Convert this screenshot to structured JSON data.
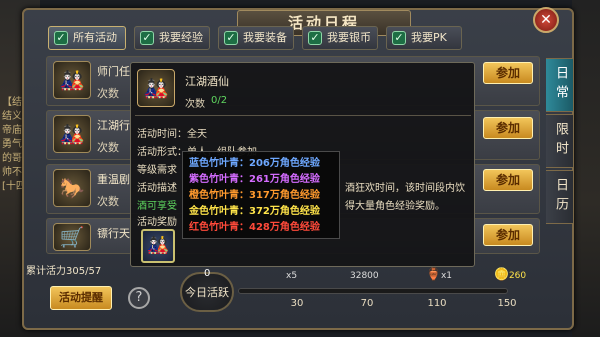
{
  "window": {
    "title": "活动日程"
  },
  "tabs": [
    {
      "label": "所有活动",
      "checked": true
    },
    {
      "label": "我要经验",
      "checked": true
    },
    {
      "label": "我要装备",
      "checked": true
    },
    {
      "label": "我要银币",
      "checked": true
    },
    {
      "label": "我要PK",
      "checked": true
    }
  ],
  "side_tabs": [
    "日常",
    "限时",
    "日历"
  ],
  "activities": [
    {
      "name": "师门任",
      "count_label": "次数",
      "join": "参加"
    },
    {
      "name": "江湖行",
      "count_label": "次数",
      "join": "参加"
    },
    {
      "name": "重温剧",
      "count_label": "次数",
      "join": "参加"
    },
    {
      "name": "镖行天",
      "count_label": "",
      "join": "参加"
    }
  ],
  "popup": {
    "title": "江湖酒仙",
    "count_label": "次数",
    "count_value": "0/2",
    "time": "活动时间：全天",
    "form": "活动形式：单人，组队参加",
    "level": "等级需求",
    "desc": "活动描述",
    "desc_tail": "酒狂欢时间，该时间段内饮",
    "enjoy": "酒可享受",
    "enjoy_tail": "得大量角色经验奖励。",
    "reward": "活动奖励"
  },
  "rewards": [
    {
      "text": "蓝色竹叶青：206万角色经验",
      "color": "#6ea8ff"
    },
    {
      "text": "紫色竹叶青：261万角色经验",
      "color": "#d46cff"
    },
    {
      "text": "橙色竹叶青：317万角色经验",
      "color": "#ff9a2e"
    },
    {
      "text": "金色竹叶青：372万角色经验",
      "color": "#ffe44a"
    },
    {
      "text": "红色竹叶青：428万角色经验",
      "color": "#ff4a3a"
    }
  ],
  "bottom": {
    "vitality": "累计活力305/57",
    "remind": "活动提醒",
    "help": "?",
    "today": "今日活跃",
    "today_value": "0",
    "milestones": [
      "30",
      "70",
      "110",
      "150"
    ],
    "chest_counts": [
      "x5",
      "32800",
      "x1",
      "260"
    ]
  },
  "background": {
    "left_text": [
      "【结义",
      "结义队",
      "帝庙与",
      "勇气考",
      "的哥哥",
      "帅不",
      "[十四"
    ]
  }
}
